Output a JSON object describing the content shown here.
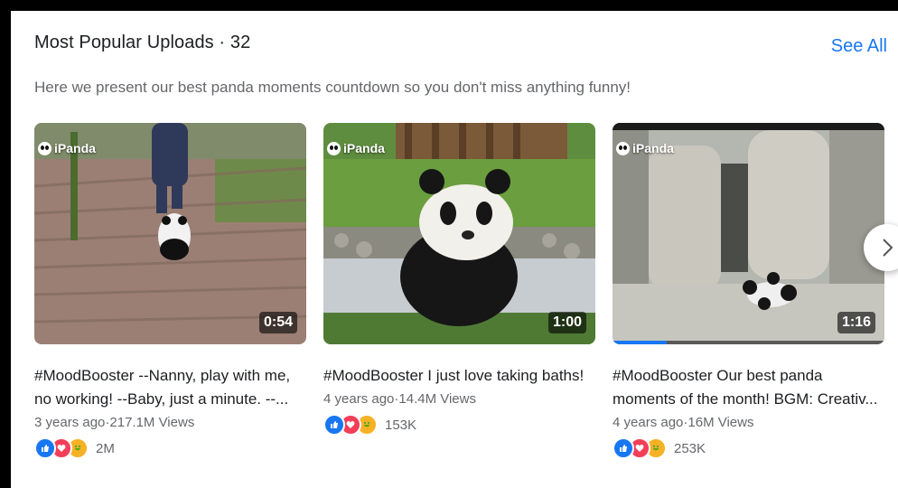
{
  "section": {
    "title": "Most Popular Uploads · 32",
    "see_all": "See All",
    "subtitle": "Here we present our best panda moments countdown so you don't miss anything funny!"
  },
  "brand_label": "iPanda",
  "videos": [
    {
      "title_line1": "#MoodBooster --Nanny, play with me,",
      "title_line2": "no working! --Baby, just a minute. --...",
      "meta": "3 years ago·217.1M Views",
      "reactions": "2M",
      "duration": "0:54"
    },
    {
      "title_line1": "#MoodBooster I just love taking baths!",
      "title_line2": "",
      "meta": "4 years ago·14.4M Views",
      "reactions": "153K",
      "duration": "1:00"
    },
    {
      "title_line1": "#MoodBooster Our best panda",
      "title_line2": "moments of the month! BGM: Creativ...",
      "meta": "4 years ago·16M Views",
      "reactions": "253K",
      "duration": "1:16",
      "watch_progress_percent": 20
    }
  ],
  "icons": {
    "reactions": [
      "like-icon",
      "love-icon",
      "haha-icon"
    ],
    "next": "chevron-right-icon"
  },
  "colors": {
    "link": "#1877f2",
    "like": "#1877f2",
    "love": "#f33e58",
    "haha": "#f7b125"
  }
}
